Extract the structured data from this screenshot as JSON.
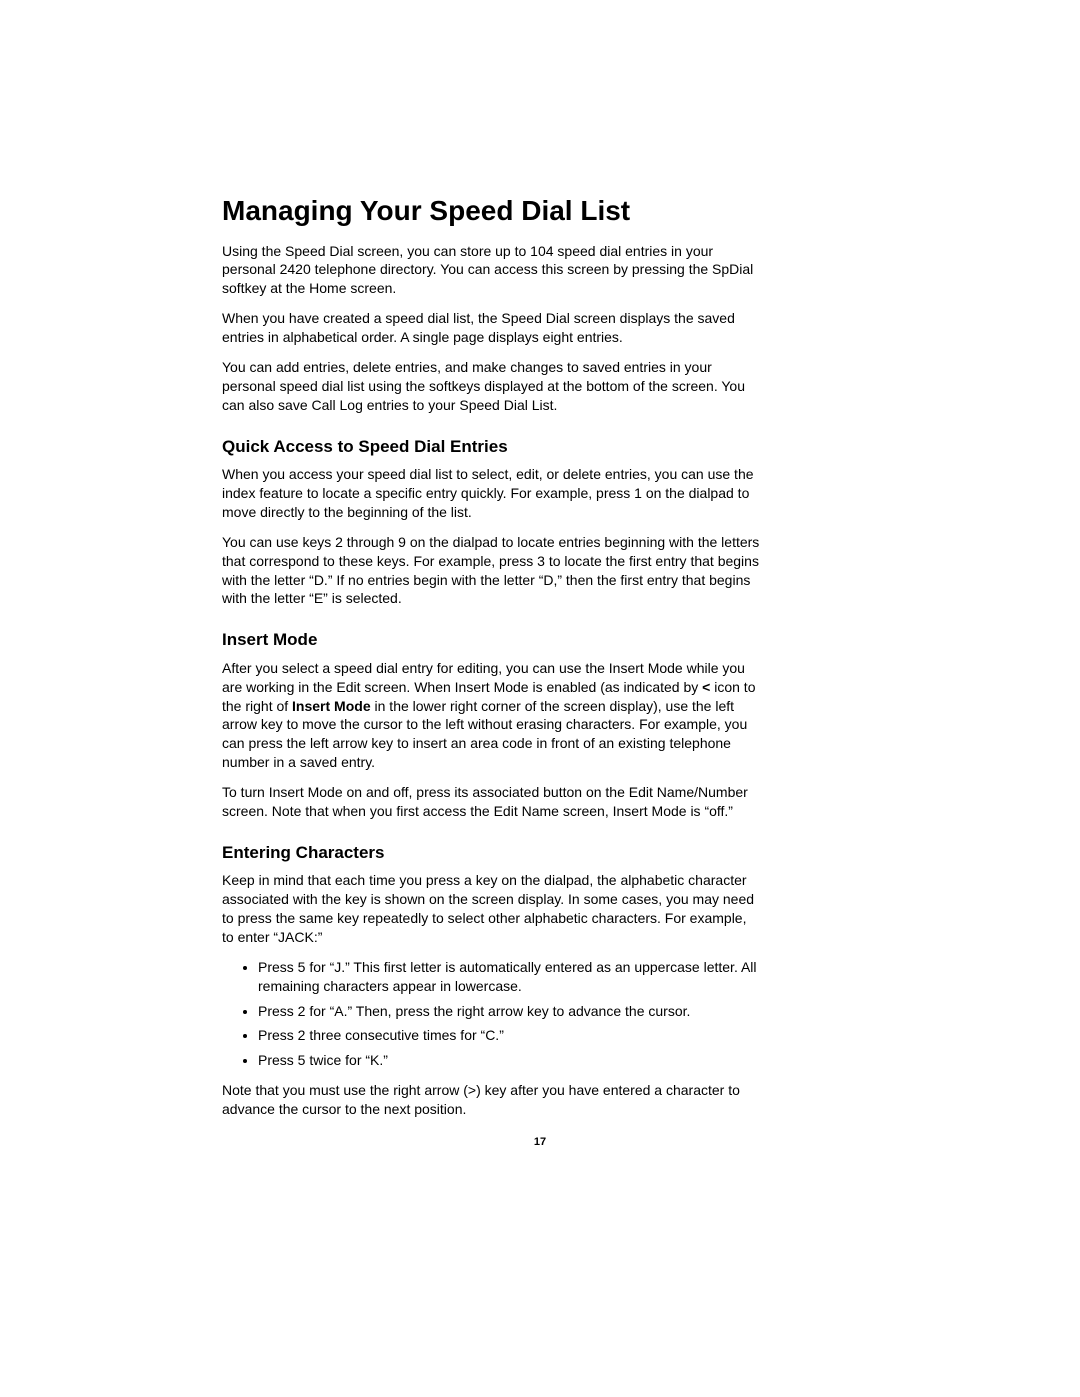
{
  "title": "Managing Your Speed Dial List",
  "intro": {
    "p1": "Using the Speed Dial screen, you can store up to 104 speed dial entries in your personal 2420 telephone directory. You can access this screen by pressing the SpDial softkey at the Home screen.",
    "p2": "When you have created a speed dial list, the Speed Dial screen displays the saved entries in alphabetical order. A single page displays eight entries.",
    "p3": "You can add entries, delete entries, and make changes to saved entries in your personal speed dial list using the softkeys displayed at the bottom of the screen. You can also save Call Log entries to your Speed Dial List."
  },
  "quick_access": {
    "heading": "Quick Access to Speed Dial Entries",
    "p1": "When you access your speed dial list to select, edit, or delete entries, you can use the index feature to locate a specific entry quickly. For example, press 1 on the dialpad to move directly to the beginning of the list.",
    "p2": "You can use keys 2 through 9 on the dialpad to locate entries beginning with the letters that correspond to these keys. For example, press 3 to locate the first entry that begins with the letter “D.” If no entries begin with the letter “D,” then the first entry that begins with the letter “E” is selected."
  },
  "insert_mode": {
    "heading": "Insert Mode",
    "p1_part1": "After you select a speed dial entry for editing, you can use the Insert Mode while you are working in the Edit screen. When Insert Mode is enabled (as indicated by ",
    "p1_bold1": "<",
    "p1_part2": " icon to the right of ",
    "p1_bold2": "Insert Mode",
    "p1_part3": " in the lower right corner of the screen display), use the left arrow key to move the cursor to the left without erasing characters. For example, you can press the left arrow key to insert an area code in front of an existing telephone number in a saved entry.",
    "p2": "To turn Insert Mode on and off, press its associated button on the Edit Name/Number screen. Note that when you first access the Edit Name screen, Insert Mode is “off.”"
  },
  "entering_chars": {
    "heading": "Entering Characters",
    "p1": "Keep in mind that each time you press a key on the dialpad, the alphabetic character associated with the key is shown on the screen display. In some cases, you may need to press the same key repeatedly to select other alphabetic characters. For example, to enter “JACK:”",
    "bullets": [
      "Press 5 for “J.” This first letter is automatically entered as an uppercase letter. All remaining characters appear in lowercase.",
      "Press 2 for “A.” Then, press the right arrow key to advance the cursor.",
      "Press 2 three consecutive times for “C.”",
      "Press 5 twice for “K.”"
    ],
    "p2": "Note that you must use the right arrow (>) key after you have entered a character to advance the cursor to the next position."
  },
  "page_number": "17"
}
